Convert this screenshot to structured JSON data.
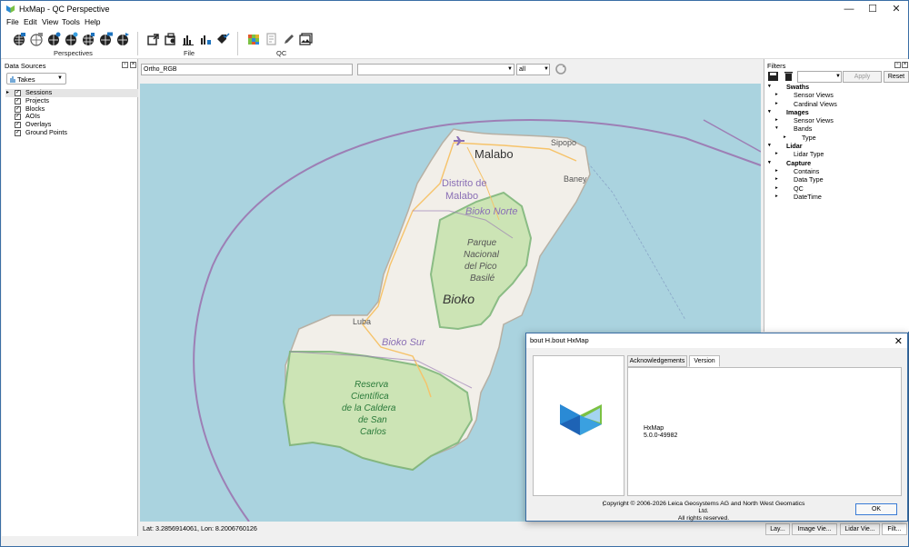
{
  "window": {
    "title": "HxMap - QC Perspective",
    "minimize": "—",
    "maximize": "☐",
    "close": "✕"
  },
  "menu": [
    "File",
    "Edit",
    "View",
    "Tools",
    "Help"
  ],
  "toolbar": {
    "groups": [
      {
        "label": "Perspectives"
      },
      {
        "label": "File"
      },
      {
        "label": "QC"
      }
    ]
  },
  "data_sources": {
    "title": "Data Sources",
    "combo_value": "Takes",
    "items": [
      {
        "label": "Sessions",
        "checked": true,
        "selected": true,
        "expandable": true
      },
      {
        "label": "Projects",
        "checked": true
      },
      {
        "label": "Blocks",
        "checked": true
      },
      {
        "label": "AOIs",
        "checked": true
      },
      {
        "label": "Overlays",
        "checked": true
      },
      {
        "label": "Ground Points",
        "checked": true
      }
    ]
  },
  "map_toolbar": {
    "layer_value": "Ortho_RGB",
    "search_value": "",
    "filter_value": "all"
  },
  "map_labels": {
    "malabo": "Malabo",
    "sipopo": "Sipopo",
    "baney": "Baney",
    "distrito": "Distrito de",
    "distrito2": "Malabo",
    "bioko_norte": "Bioko Norte",
    "parque1": "Parque",
    "parque2": "Nacional",
    "parque3": "del Pico",
    "parque4": "Basilé",
    "bioko": "Bioko",
    "luba": "Luba",
    "bioko_sur": "Bioko Sur",
    "reserva1": "Reserva",
    "reserva2": "Científica",
    "reserva3": "de la Caldera",
    "reserva4": "de San",
    "reserva5": "Carlos"
  },
  "status": {
    "coords": "Lat: 3.2856914061, Lon: 8.2006760126"
  },
  "filters": {
    "title": "Filters",
    "apply_label": "Apply",
    "reset_label": "Reset",
    "tree": [
      {
        "label": "Swaths",
        "level": 0,
        "bold": true
      },
      {
        "label": "Sensor Views",
        "level": 1
      },
      {
        "label": "Cardinal Views",
        "level": 1
      },
      {
        "label": "Images",
        "level": 0,
        "bold": true
      },
      {
        "label": "Sensor Views",
        "level": 1
      },
      {
        "label": "Bands",
        "level": 1
      },
      {
        "label": "Type",
        "level": 2
      },
      {
        "label": "Lidar",
        "level": 0,
        "bold": true
      },
      {
        "label": "Lidar Type",
        "level": 1
      },
      {
        "label": "Capture",
        "level": 0,
        "bold": true
      },
      {
        "label": "Contains",
        "level": 1
      },
      {
        "label": "Data Type",
        "level": 1
      },
      {
        "label": "QC",
        "level": 1
      },
      {
        "label": "DateTime",
        "level": 1
      }
    ]
  },
  "bottom_tabs": [
    "Lay...",
    "Image Vie...",
    "Lidar Vie...",
    "Filt..."
  ],
  "about_dialog": {
    "title": "bout H.bout HxMap",
    "tabs": [
      "Acknowledgements",
      "Version"
    ],
    "active_tab": "Version",
    "product": "HxMap",
    "version": "5.0.0-49982",
    "copyright1": "Copyright © 2006-2026 Leica Geosystems AG and North West Geomatics Ltd.",
    "copyright2": "All rights reserved.",
    "ok_label": "OK",
    "colon": ":"
  },
  "colors": {
    "water": "#aad3df",
    "land": "#f2efe9",
    "park": "#c8e3b0",
    "boundary": "#9d7fb5",
    "road": "#f6c36a"
  }
}
